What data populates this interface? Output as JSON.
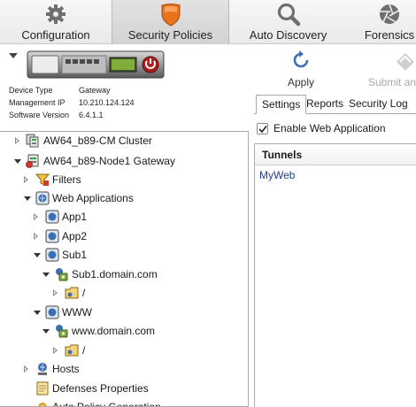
{
  "ribbon": {
    "tabs": [
      {
        "label": "Configuration",
        "icon": "gear-icon",
        "active": false
      },
      {
        "label": "Security Policies",
        "icon": "shield-icon",
        "active": true
      },
      {
        "label": "Auto Discovery",
        "icon": "magnifier-icon",
        "active": false
      },
      {
        "label": "Forensics",
        "icon": "aperture-icon",
        "active": false
      }
    ]
  },
  "device": {
    "fields": [
      {
        "key": "Device Type",
        "value": "Gateway"
      },
      {
        "key": "Management IP",
        "value": "10.210.124.124"
      },
      {
        "key": "Software Version",
        "value": "6.4.1.1"
      }
    ]
  },
  "toolbar": {
    "apply_label": "Apply",
    "submit_label": "Submit and"
  },
  "tree": {
    "nodes": [
      {
        "label": "AW64_b89-CM Cluster",
        "icon": "cluster-icon"
      },
      {
        "label": "AW64_b89-Node1 Gateway",
        "icon": "gateway-icon"
      },
      {
        "label": "Filters",
        "icon": "funnel-icon"
      },
      {
        "label": "Web Applications",
        "icon": "web-applications-icon"
      },
      {
        "label": "App1",
        "icon": "application-icon"
      },
      {
        "label": "App2",
        "icon": "application-icon"
      },
      {
        "label": "Sub1",
        "icon": "application-icon"
      },
      {
        "label": "Sub1.domain.com",
        "icon": "host-icon"
      },
      {
        "label": "/",
        "icon": "folder-icon"
      },
      {
        "label": "WWW",
        "icon": "application-icon"
      },
      {
        "label": "www.domain.com",
        "icon": "host-icon"
      },
      {
        "label": "/",
        "icon": "folder-icon"
      },
      {
        "label": "Hosts",
        "icon": "hosts-icon"
      },
      {
        "label": "Defenses Properties",
        "icon": "document-icon"
      },
      {
        "label": "Auto Policy Generation",
        "icon": "gear-icon"
      }
    ]
  },
  "panel": {
    "tabs": [
      "Settings",
      "Reports",
      "Security Log"
    ],
    "selected_tab": "Settings",
    "enable_label": "Enable Web Application",
    "enable_checked": true,
    "grid_header": "Tunnels",
    "rows": [
      "MyWeb"
    ]
  },
  "colors": {
    "shield": "#e8731c",
    "selected_tab_bg": "#d6d6d6",
    "link_text": "#1f3f8a",
    "apply_bg": "#f8d98a"
  }
}
